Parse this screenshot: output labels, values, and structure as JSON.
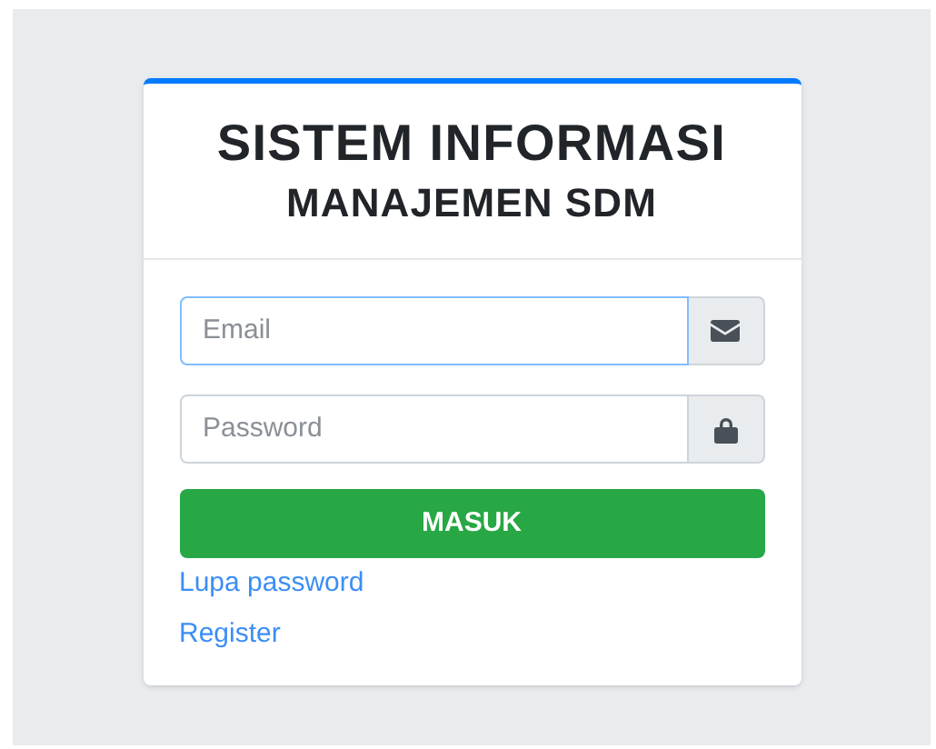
{
  "title_lines": [
    "SISTEM INFORMASI",
    "MANAJEMEN SDM"
  ],
  "fields": [
    {
      "placeholder": "Email",
      "kind": "email",
      "focused": true
    },
    {
      "placeholder": "Password",
      "kind": "password",
      "focused": false
    }
  ],
  "submit": "MASUK",
  "links": [
    "Lupa password",
    "Register"
  ]
}
